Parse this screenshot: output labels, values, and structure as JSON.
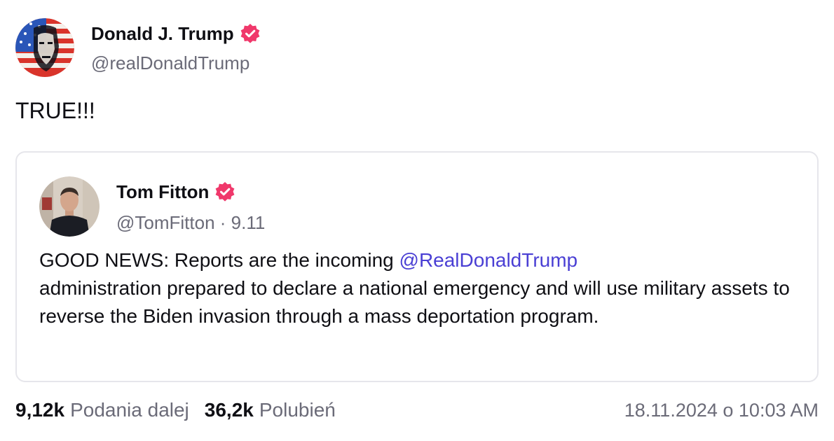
{
  "post": {
    "author": {
      "display_name": "Donald J. Trump",
      "handle": "@realDonaldTrump",
      "avatar_icon": "avatar-flag-portrait",
      "verified_icon": "verified-badge-icon"
    },
    "text": "TRUE!!!"
  },
  "quote": {
    "author": {
      "display_name": "Tom Fitton",
      "handle": "@TomFitton",
      "separator": " · ",
      "date": "9.11",
      "avatar_icon": "avatar-photo",
      "verified_icon": "verified-badge-icon"
    },
    "body_prefix": "GOOD NEWS: Reports are the incoming ",
    "mention": "@RealDonaldTrump",
    "body_suffix": " administration prepared to declare a national emergency and will use military assets to reverse the Biden invasion through a mass deportation program."
  },
  "footer": {
    "reposts_count": "9,12k",
    "reposts_label": "Podania dalej",
    "likes_count": "36,2k",
    "likes_label": "Polubień",
    "timestamp": "18.11.2024 o 10:03 AM"
  },
  "colors": {
    "verified": "#f0386b",
    "mention": "#4a3fd4",
    "secondary_text": "#6b6b78",
    "card_border": "#e6e6eb"
  }
}
